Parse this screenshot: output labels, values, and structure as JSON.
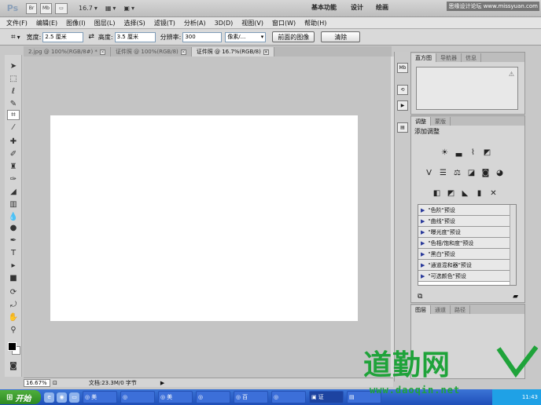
{
  "appbar": {
    "logo": "Ps",
    "btn_br": "Br",
    "btn_mb": "Mb",
    "zoom": "16.7",
    "workspaces": [
      "基本功能",
      "设计",
      "绘画"
    ],
    "brand": "思缘设计论坛 www.missyuan.com"
  },
  "menu": [
    "文件(F)",
    "编辑(E)",
    "图像(I)",
    "图层(L)",
    "选择(S)",
    "滤镜(T)",
    "分析(A)",
    "3D(D)",
    "视图(V)",
    "窗口(W)",
    "帮助(H)"
  ],
  "options": {
    "width_label": "宽度:",
    "width_value": "2.5 厘米",
    "height_label": "高度:",
    "height_value": "3.5 厘米",
    "res_label": "分辨率:",
    "res_value": "300",
    "unit_value": "像素/...",
    "front_btn": "前面的图像",
    "clear_btn": "清除"
  },
  "tabs": [
    {
      "label": "2.jpg @ 100%(RGB/8#) *",
      "active": false
    },
    {
      "label": "证件照 @ 100%(RGB/8)",
      "active": false
    },
    {
      "label": "证件照 @ 16.7%(RGB/8)",
      "active": true
    }
  ],
  "status": {
    "zoom": "16.67%",
    "doc": "文档:23.3M/0 字节"
  },
  "dock": {
    "mb": "Mb"
  },
  "histogram_panel": {
    "tabs": [
      "直方图",
      "导航器",
      "信息"
    ]
  },
  "adjust_panel": {
    "tabs": [
      "调整",
      "蒙版"
    ],
    "title": "添加调整",
    "presets": [
      "\"色阶\"预设",
      "\"曲线\"预设",
      "\"曝光度\"预设",
      "\"色相/饱和度\"预设",
      "\"黑白\"预设",
      "\"通道混和器\"预设",
      "\"可选颜色\"预设"
    ]
  },
  "layers_panel": {
    "tabs": [
      "图层",
      "通道",
      "路径"
    ]
  },
  "taskbar": {
    "start": "开始",
    "buttons": [
      "美",
      "",
      "美",
      "",
      "百",
      "",
      "证",
      "",
      ""
    ],
    "clock": "11:43"
  },
  "watermark": {
    "title": "道勤网",
    "url": "www.daoqin.net"
  },
  "colors": {
    "accent_green": "#1fa33a",
    "taskbar_blue": "#2a5fd0"
  }
}
